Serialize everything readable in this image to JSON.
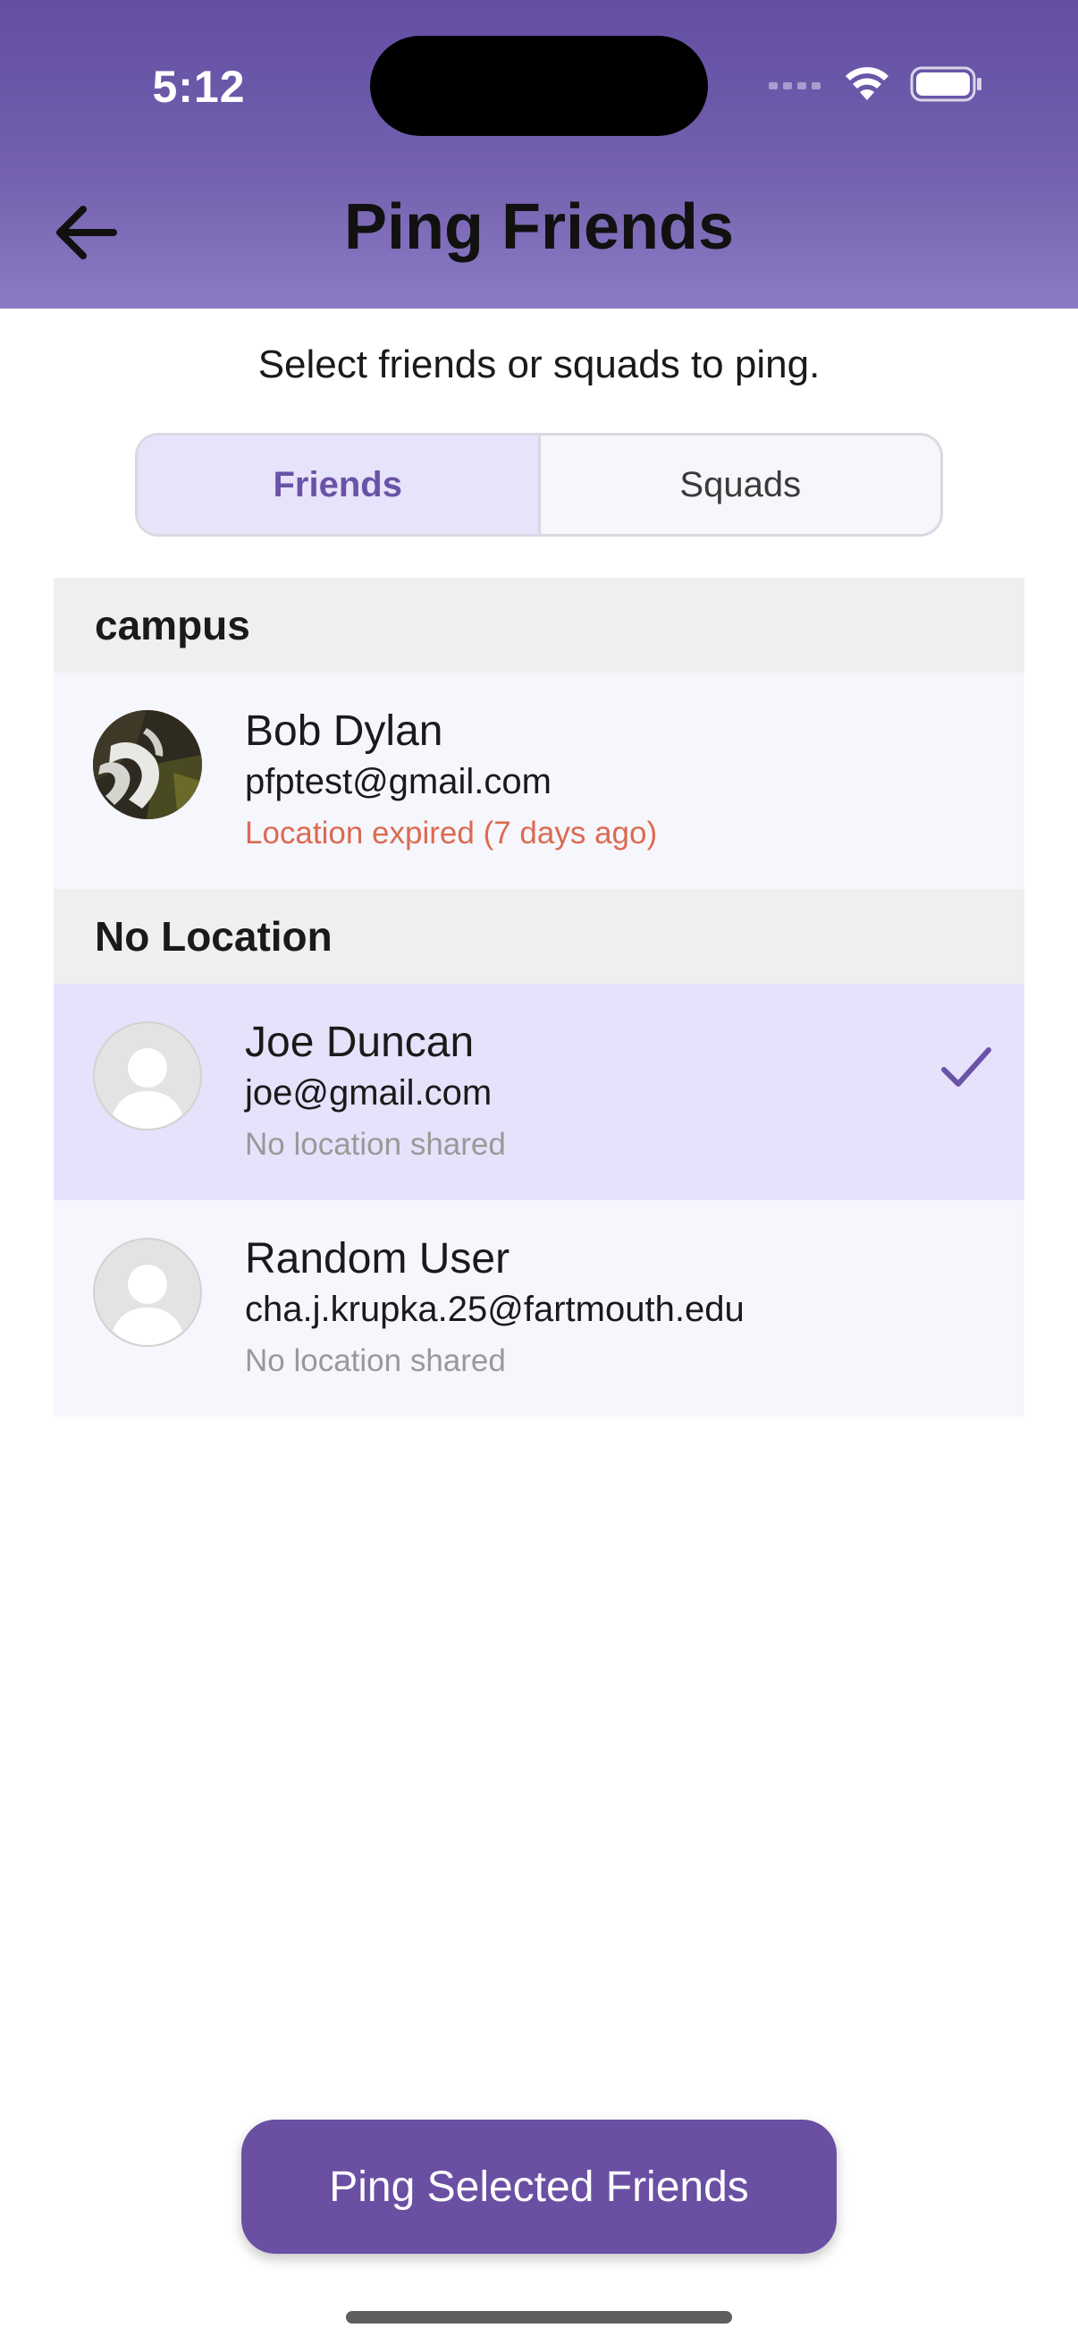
{
  "status_bar": {
    "time": "5:12"
  },
  "header": {
    "title": "Ping Friends"
  },
  "subtitle": "Select friends or squads to ping.",
  "segmented": {
    "tabs": [
      "Friends",
      "Squads"
    ],
    "selected": "Friends"
  },
  "sections": [
    {
      "title": "campus",
      "rows": [
        {
          "name": "Bob Dylan",
          "email": "pfptest@gmail.com",
          "status": "Location expired (7 days ago)",
          "selected": false
        }
      ]
    },
    {
      "title": "No Location",
      "rows": [
        {
          "name": "Joe Duncan",
          "email": "joe@gmail.com",
          "status": "No location shared",
          "selected": true
        },
        {
          "name": "Random User",
          "email": "cha.j.krupka.25@fartmouth.edu",
          "status": "No location shared",
          "selected": false
        }
      ]
    }
  ],
  "ping_button": {
    "label": "Ping Selected Friends"
  },
  "colors": {
    "accent": "#6a4fa3",
    "selected_row": "#e6e2fb",
    "expired": "#dc6a50"
  }
}
